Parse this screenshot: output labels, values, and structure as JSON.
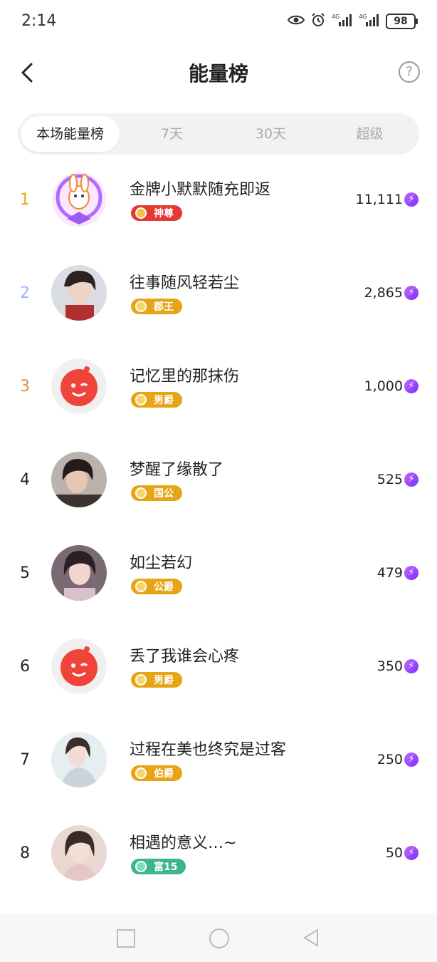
{
  "status": {
    "time": "2:14",
    "battery": "98",
    "signal_label": "4G"
  },
  "header": {
    "title": "能量榜",
    "help": "?"
  },
  "tabs": [
    {
      "label": "本场能量榜",
      "active": true
    },
    {
      "label": "7天",
      "active": false
    },
    {
      "label": "30天",
      "active": false
    },
    {
      "label": "超级",
      "active": false
    }
  ],
  "rank_colors": {
    "1": "#f0a020",
    "2": "#9fb0ff",
    "3": "#e09040",
    "default": "#222222"
  },
  "rows": [
    {
      "rank": "1",
      "name": "金牌小默默随充即返",
      "badge": "神尊",
      "badge_color": "#e53935",
      "score": "11,111",
      "avatar": "mascot-avatar"
    },
    {
      "rank": "2",
      "name": "往事随风轻若尘",
      "badge": "郡王",
      "badge_color": "#e6a417",
      "score": "2,865",
      "avatar": "photo-avatar"
    },
    {
      "rank": "3",
      "name": "记忆里的那抹伤",
      "badge": "男爵",
      "badge_color": "#e6a417",
      "score": "1,000",
      "avatar": "default-avatar"
    },
    {
      "rank": "4",
      "name": "梦醒了缘散了",
      "badge": "国公",
      "badge_color": "#e6a417",
      "score": "525",
      "avatar": "photo-avatar"
    },
    {
      "rank": "5",
      "name": "如尘若幻",
      "badge": "公爵",
      "badge_color": "#e6a417",
      "score": "479",
      "avatar": "photo-avatar"
    },
    {
      "rank": "6",
      "name": "丢了我谁会心疼",
      "badge": "男爵",
      "badge_color": "#e6a417",
      "score": "350",
      "avatar": "default-avatar"
    },
    {
      "rank": "7",
      "name": "过程在美也终究是过客",
      "badge": "伯爵",
      "badge_color": "#e6a417",
      "score": "250",
      "avatar": "photo-avatar"
    },
    {
      "rank": "8",
      "name": "相遇的意义…~",
      "badge": "富15",
      "badge_color": "#3bb58a",
      "score": "50",
      "avatar": "photo-avatar"
    }
  ]
}
